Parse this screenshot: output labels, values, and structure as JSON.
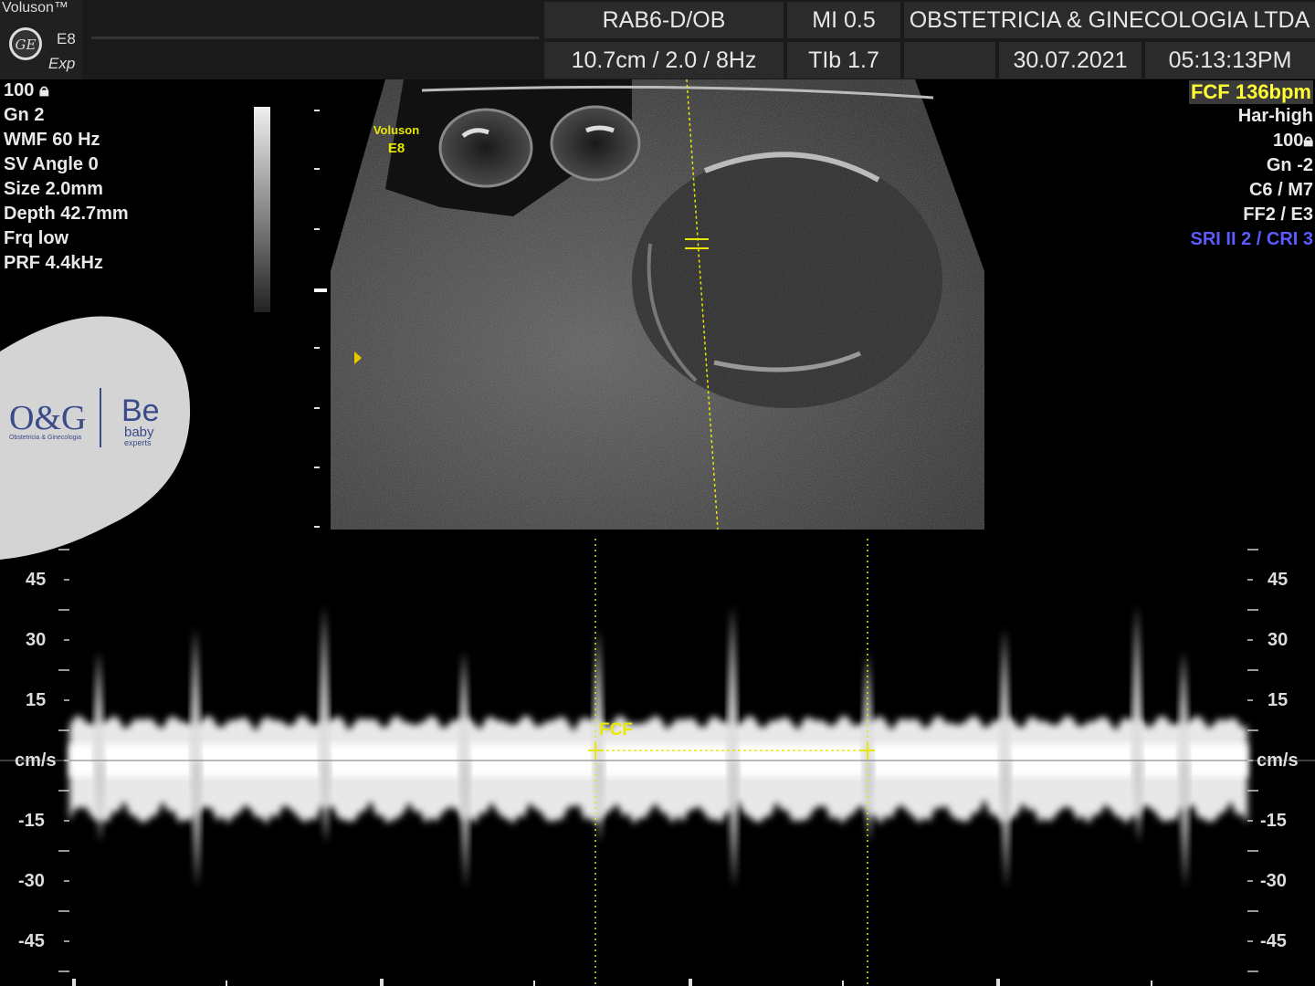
{
  "header": {
    "brand": "Voluson™",
    "model": "E8",
    "edition": "Exp",
    "probe": "RAB6-D/OB",
    "mi": "MI  0.5",
    "clinic": "OBSTETRICIA & GINECOLOGIA LTDA",
    "depth_freq": "10.7cm / 2.0 /  8Hz",
    "tib": "TIb  1.7",
    "date": "30.07.2021",
    "time": "05:13:13PM"
  },
  "left_params": [
    "100",
    "Gn  2",
    "WMF 60 Hz",
    "SV Angle  0",
    "Size  2.0mm",
    "Depth 42.7mm",
    "Frq low",
    "PRF  4.4kHz"
  ],
  "right_params": {
    "fcf": "FCF 136bpm",
    "items": [
      "Har-high",
      "100",
      "Gn  -2",
      "C6 / M7",
      "FF2 / E3"
    ],
    "sri": "SRI II 2 / CRI 3",
    "sri_color": "#5b5bff",
    "fcf_color": "#ffff33"
  },
  "scan_label": {
    "line1": "Voluson",
    "line2": "E8"
  },
  "logo": {
    "brand": "O&G",
    "subtitle": "Obstetricia & Ginecologia",
    "brand2": "Be",
    "baby": "baby",
    "experts": "experts"
  },
  "doppler": {
    "unit": "cm/s",
    "scale_labels": [
      "45",
      "30",
      "15",
      "-15",
      "-30",
      "-45"
    ],
    "measure_label": "FCF",
    "measure_color": "#ffff33"
  }
}
